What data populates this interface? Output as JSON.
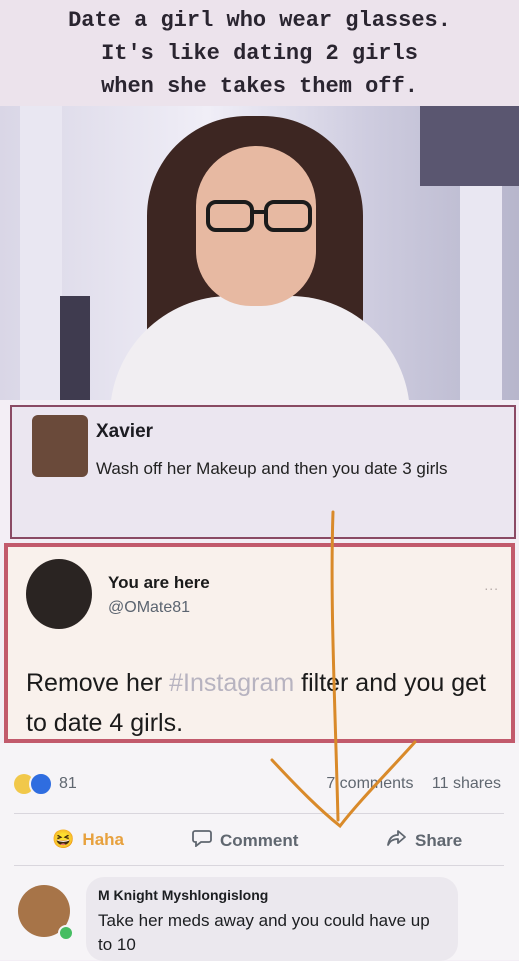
{
  "meme": {
    "caption": "Date a girl who wear glasses.\nIt's like dating 2 girls\nwhen she takes them off."
  },
  "xavier_comment": {
    "name": "Xavier",
    "text": "Wash off her Makeup and then you date 3 girls"
  },
  "tweet": {
    "name": "You are here",
    "handle": "@OMate81",
    "more": "...",
    "text_before": "Remove her ",
    "hashtag": "#Instagram",
    "text_after": " filter and you get to date 4 girls."
  },
  "facebook_post": {
    "reaction_count": "81",
    "comments": "7 comments",
    "shares": "11 shares",
    "actions": {
      "haha": "Haha",
      "comment": "Comment",
      "share": "Share"
    },
    "comment": {
      "author": "M Knight Myshlongislong",
      "text": "Take her meds away and you could have up to 10"
    }
  },
  "colors": {
    "arrow": "#d98a2a",
    "card_border_xavier": "#8a4a64",
    "card_border_tweet": "#c25a6c",
    "facebook_grey": "#606770"
  },
  "icons": [
    "haha-emoji-icon",
    "like-icon",
    "comment-icon",
    "share-icon",
    "more-icon",
    "online-status-icon"
  ]
}
